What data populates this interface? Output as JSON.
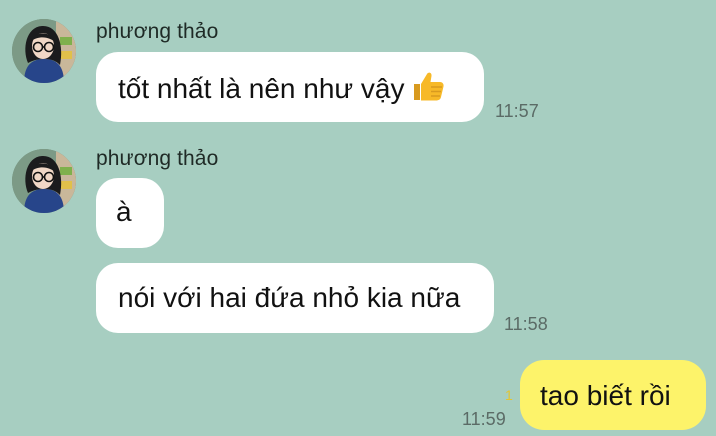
{
  "conversation": {
    "groups": [
      {
        "sender": "phương thảo",
        "messages": [
          {
            "text": "tốt nhất là nên như vậy",
            "emoji": "thumbs-up-icon",
            "time": "11:57"
          }
        ]
      },
      {
        "sender": "phương thảo",
        "messages": [
          {
            "text": "à",
            "time": ""
          },
          {
            "text": "nói với hai đứa nhỏ kia nữa",
            "time": "11:58"
          }
        ]
      }
    ],
    "outgoing": {
      "text": "tao biết rồi",
      "time": "11:59",
      "read_count": "1"
    }
  },
  "colors": {
    "background": "#a7cec1",
    "incoming_bubble": "#ffffff",
    "outgoing_bubble": "#fdf36a",
    "read_count": "#e4c531"
  }
}
